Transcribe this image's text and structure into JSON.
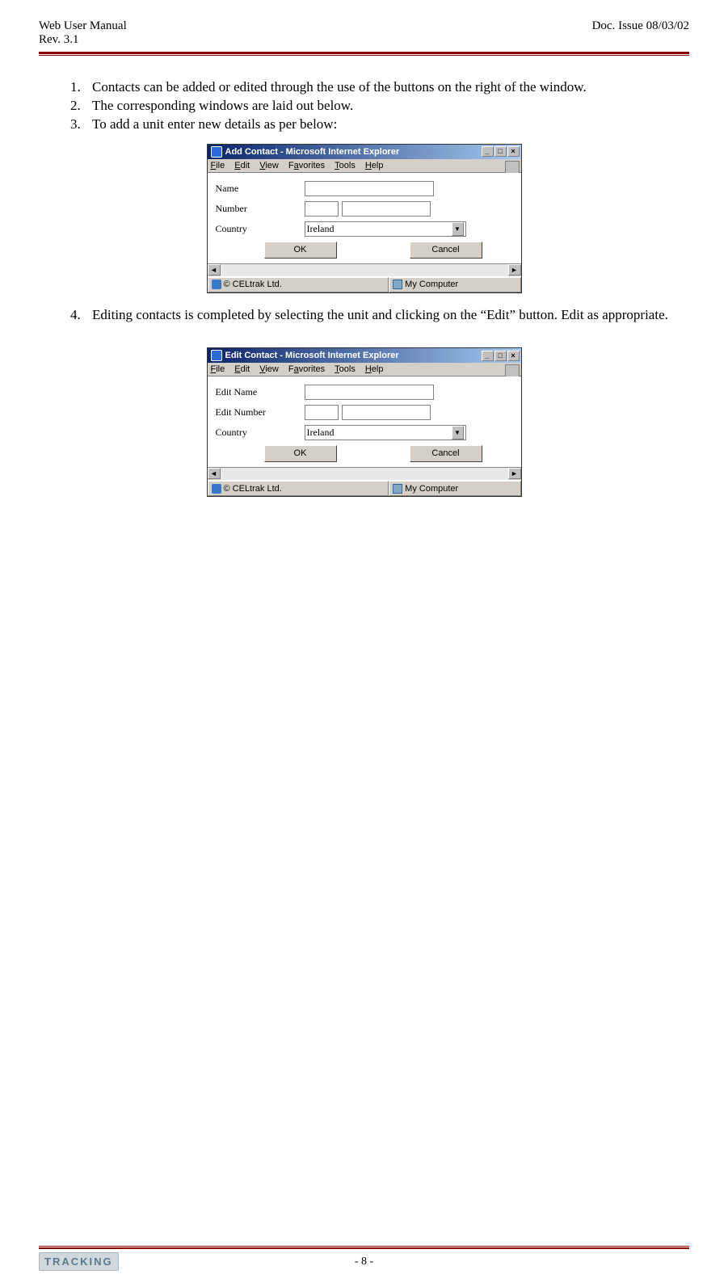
{
  "header": {
    "title": "Web User Manual",
    "revision": "Rev. 3.1",
    "doc_issue": "Doc. Issue 08/03/02"
  },
  "list": {
    "item1": "Contacts can be added or edited through the use of the buttons on the right of the window.",
    "item2": "The corresponding windows are laid out below.",
    "item3": "To add a unit enter new details as per below:",
    "item4": "Editing contacts is completed by selecting the unit and clicking on the “Edit” button. Edit as appropriate."
  },
  "dialogs": {
    "add": {
      "title": "Add Contact - Microsoft Internet Explorer",
      "menu": {
        "file": "File",
        "edit": "Edit",
        "view": "View",
        "favorites": "Favorites",
        "tools": "Tools",
        "help": "Help"
      },
      "labels": {
        "name": "Name",
        "number": "Number",
        "country": "Country"
      },
      "country_value": "Ireland",
      "buttons": {
        "ok": "OK",
        "cancel": "Cancel"
      },
      "status_left": "© CELtrak Ltd.",
      "status_right": "My Computer"
    },
    "edit": {
      "title": "Edit Contact - Microsoft Internet Explorer",
      "menu": {
        "file": "File",
        "edit": "Edit",
        "view": "View",
        "favorites": "Favorites",
        "tools": "Tools",
        "help": "Help"
      },
      "labels": {
        "name": "Edit Name",
        "number": "Edit Number",
        "country": "Country"
      },
      "country_value": "Ireland",
      "buttons": {
        "ok": "OK",
        "cancel": "Cancel"
      },
      "status_left": "© CELtrak Ltd.",
      "status_right": "My Computer"
    }
  },
  "footer": {
    "logo": "TRACKING",
    "page": "- 8 -"
  }
}
